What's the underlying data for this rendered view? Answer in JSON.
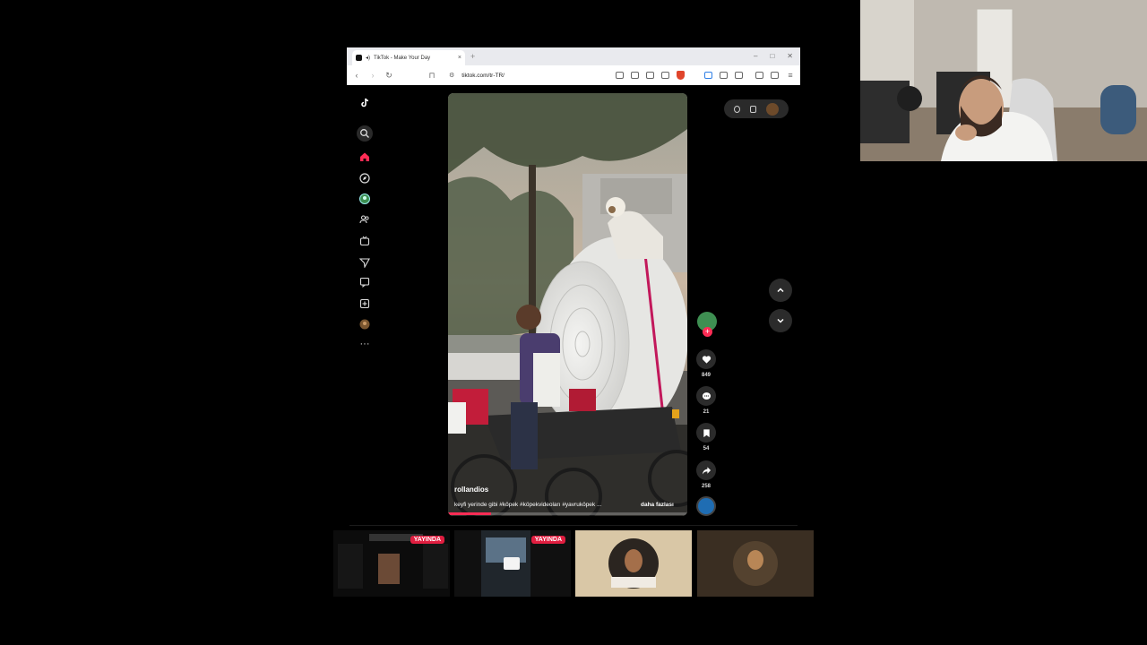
{
  "browser": {
    "tab_title": "TikTok - Make Your Day",
    "tab_close": "×",
    "new_tab": "+",
    "url": "tiktok.com/tr-TR/",
    "window_controls": [
      "–",
      "□",
      "✕"
    ]
  },
  "sidebar": {
    "icons": [
      "tiktok-logo-icon",
      "search-icon",
      "home-icon",
      "explore-icon",
      "live-icon",
      "following-icon",
      "live-tv-icon",
      "messages-icon",
      "inbox-icon",
      "upload-icon",
      "profile-icon",
      "more-icon"
    ],
    "more_label": "···"
  },
  "video": {
    "author": "rollandios",
    "caption": "keyfi yerinde gibi #köpek #köpekvideoları #yavruköpek ...",
    "more_label": "daha fazlası",
    "progress": 0.18
  },
  "actions": {
    "likes": "849",
    "comments": "21",
    "saves": "54",
    "shares": "258"
  },
  "thumbnails": [
    {
      "badge": "YAYINDA"
    },
    {
      "badge": "YAYINDA"
    },
    {
      "badge": ""
    },
    {
      "badge": ""
    }
  ],
  "colors": {
    "accent": "#fe2c55",
    "badge": "#e01e40",
    "background": "#000000"
  }
}
